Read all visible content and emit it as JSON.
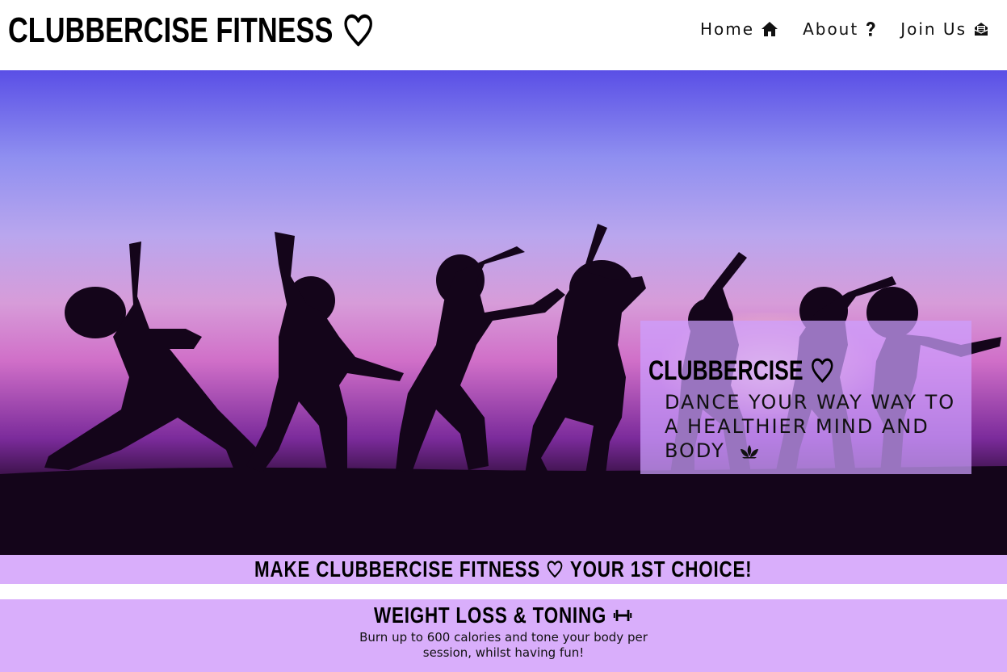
{
  "header": {
    "brand": "CLUBBERCISE FITNESS",
    "brand_icon": "heart-outline-icon",
    "nav": [
      {
        "label": "Home",
        "icon": "home-icon"
      },
      {
        "label": "About",
        "icon": "question-icon"
      },
      {
        "label": "Join Us",
        "icon": "envelope-icon"
      }
    ]
  },
  "hero": {
    "image": "dancers-silhouette-sunset",
    "overlay_title": "CLUBBERCISE",
    "overlay_icon": "heart-outline-icon",
    "tagline": "DANCE YOUR WAY WAY TO A HEALTHIER MIND AND BODY",
    "tagline_icon": "lotus-icon"
  },
  "banner": {
    "text_before": "MAKE CLUBBERCISE FITNESS",
    "icon": "heart-outline-icon",
    "text_after": "YOUR 1ST CHOICE!"
  },
  "feature": {
    "title": "WEIGHT LOSS & TONING",
    "icon": "dumbbell-icon",
    "description": "Burn up to 600 calories and tone your body per session, whilst having fun!"
  },
  "colors": {
    "accent": "#d9aefb",
    "overlay": "#cda0ff",
    "text": "#000000"
  }
}
